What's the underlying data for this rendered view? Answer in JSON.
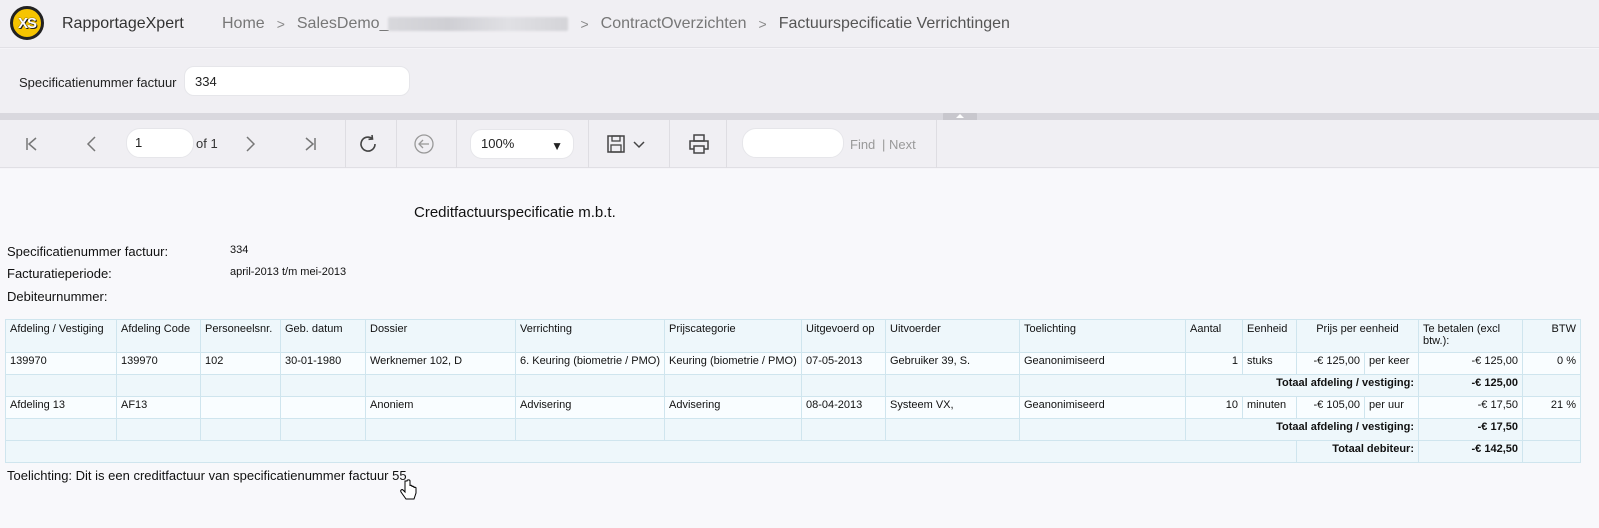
{
  "header": {
    "logo_text": "XS",
    "app_name": "RapportageXpert",
    "breadcrumbs": [
      "Home",
      "SalesDemo_",
      "ContractOverzichten",
      "Factuurspecificatie Verrichtingen"
    ]
  },
  "parameters": {
    "label": "Specificatienummer factuur",
    "value": "334"
  },
  "toolbar": {
    "page_value": "1",
    "of_label": "of 1",
    "zoom": "100%",
    "zoom_options": [
      "100%"
    ],
    "find_label": "Find",
    "next_label": "| Next",
    "find_value": ""
  },
  "report": {
    "title": "Creditfactuurspecificatie m.b.t.",
    "info": [
      {
        "label": "Specificatienummer factuur:",
        "value": "334"
      },
      {
        "label": "Facturatieperiode:",
        "value": "april-2013 t/m mei-2013"
      },
      {
        "label": "Debiteurnummer:",
        "value": ""
      }
    ],
    "columns": [
      "Afdeling / Vestiging",
      "Afdeling Code",
      "Personeelsnr.",
      "Geb. datum",
      "Dossier",
      "Verrichting",
      "Prijscategorie",
      "Uitgevoerd op",
      "Uitvoerder",
      "Toelichting",
      "Aantal",
      "Eenheid",
      "Prijs per eenheid",
      "Te betalen (excl btw.):",
      "BTW"
    ],
    "rows": [
      {
        "afdeling": "139970",
        "code": "139970",
        "personeelsnr": "102",
        "geb_datum": "30-01-1980",
        "dossier": "Werknemer 102, D",
        "verrichting": "6. Keuring (biometrie / PMO)",
        "prijscategorie": "Keuring (biometrie / PMO)",
        "uitgevoerd_op": "07-05-2013",
        "uitvoerder": "Gebruiker 39, S.",
        "toelichting": "Geanonimiseerd",
        "aantal": "1",
        "eenheid": "stuks",
        "prijs": "-€ 125,00",
        "per": "per keer",
        "te_betalen": "-€ 125,00",
        "btw": "0 %",
        "subtotal_label": "Totaal afdeling / vestiging:",
        "subtotal": "-€ 125,00"
      },
      {
        "afdeling": "Afdeling 13",
        "code": "AF13",
        "personeelsnr": "",
        "geb_datum": "",
        "dossier": "Anoniem",
        "verrichting": "Advisering",
        "prijscategorie": "Advisering",
        "uitgevoerd_op": "08-04-2013",
        "uitvoerder": "Systeem VX,",
        "toelichting": "Geanonimiseerd",
        "aantal": "10",
        "eenheid": "minuten",
        "prijs": "-€ 105,00",
        "per": "per uur",
        "te_betalen": "-€ 17,50",
        "btw": "21 %",
        "subtotal_label": "Totaal afdeling / vestiging:",
        "subtotal": "-€ 17,50"
      }
    ],
    "total_label": "Totaal debiteur:",
    "total": "-€ 142,50",
    "note": "Toelichting: Dit is een creditfactuur van specificatienummer factuur 55"
  }
}
